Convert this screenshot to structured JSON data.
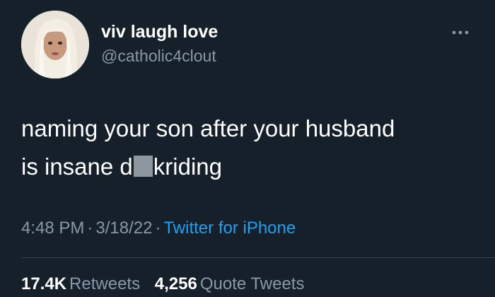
{
  "user": {
    "display_name": "viv laugh love",
    "handle": "@catholic4clout"
  },
  "tweet": {
    "line1": "naming your son after your husband",
    "line2_prefix": "is insane d",
    "line2_suffix": "kriding",
    "time": "4:48 PM",
    "separator": "·",
    "date": "3/18/22",
    "source": "Twitter for iPhone"
  },
  "stats": {
    "retweets_count": "17.4K",
    "retweets_label": "Retweets",
    "quotes_count": "4,256",
    "quotes_label": "Quote Tweets"
  },
  "colors": {
    "background": "#15202b",
    "secondary_text": "#8899a6",
    "link": "#1da1f2",
    "divider": "#38444d",
    "censor_block": "#8e96a0"
  },
  "icons": {
    "more": "more-horizontal-icon",
    "avatar": "profile-photo"
  }
}
